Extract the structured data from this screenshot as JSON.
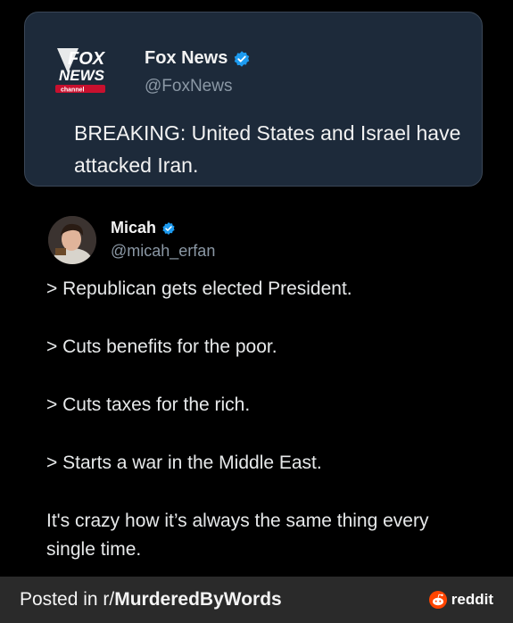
{
  "quoted_tweet": {
    "logo_text": [
      "FOX",
      "NEWS",
      "channel"
    ],
    "display_name": "Fox News",
    "handle": "@FoxNews",
    "text": "BREAKING: United States and Israel have attacked Iran."
  },
  "tweet": {
    "display_name": "Micah",
    "handle": "@micah_erfan",
    "lines": [
      "> Republican gets elected President.",
      "> Cuts benefits for the poor.",
      "> Cuts taxes for the rich.",
      "> Starts a war in the Middle East."
    ],
    "closing": "It's crazy how it’s always the same thing every single time."
  },
  "footer": {
    "posted_prefix": "Posted in r/",
    "subreddit": "MurderedByWords",
    "brand": "reddit"
  },
  "colors": {
    "background": "#000000",
    "card": "#1d2a3a",
    "verified": "#1d9bf0",
    "footer": "#2a2a2a",
    "reddit_orange": "#ff4500"
  },
  "icons": {
    "verified": "verified-badge-icon",
    "reddit": "reddit-logo-icon"
  }
}
